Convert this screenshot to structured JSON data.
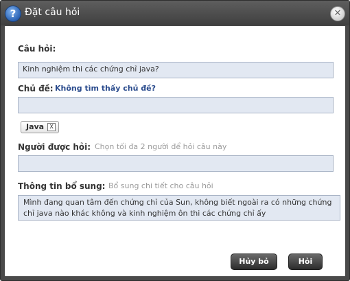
{
  "dialog": {
    "title": "Đặt câu hỏi",
    "icons": {
      "help": "question-icon",
      "close": "close-icon"
    }
  },
  "question": {
    "label": "Câu hỏi:",
    "value": "Kinh nghiệm thi các chứng chỉ java?"
  },
  "topic": {
    "label": "Chủ đề:",
    "not_found_link": "Không tìm thấy chủ đề?",
    "value": "",
    "tags": [
      {
        "label": "Java",
        "remove": "X"
      }
    ]
  },
  "asked_person": {
    "label": "Người được hỏi:",
    "hint": "Chọn tối đa 2 người để hỏi câu này",
    "value": ""
  },
  "extra_info": {
    "label": "Thông tin bổ sung:",
    "hint": "Bổ sung chi tiết cho câu hỏi",
    "value": "Mình đang quan tâm đến chứng chỉ của Sun, không biết ngoài ra có những chứng chỉ java nào khác không và kinh nghiệm ôn thi các chứng chỉ ấy"
  },
  "buttons": {
    "cancel": "Hủy bỏ",
    "ask": "Hỏi"
  },
  "colors": {
    "field_bg": "#e2e8f2",
    "link": "#2a4b8d",
    "titlebar": "#4a4a4a"
  }
}
